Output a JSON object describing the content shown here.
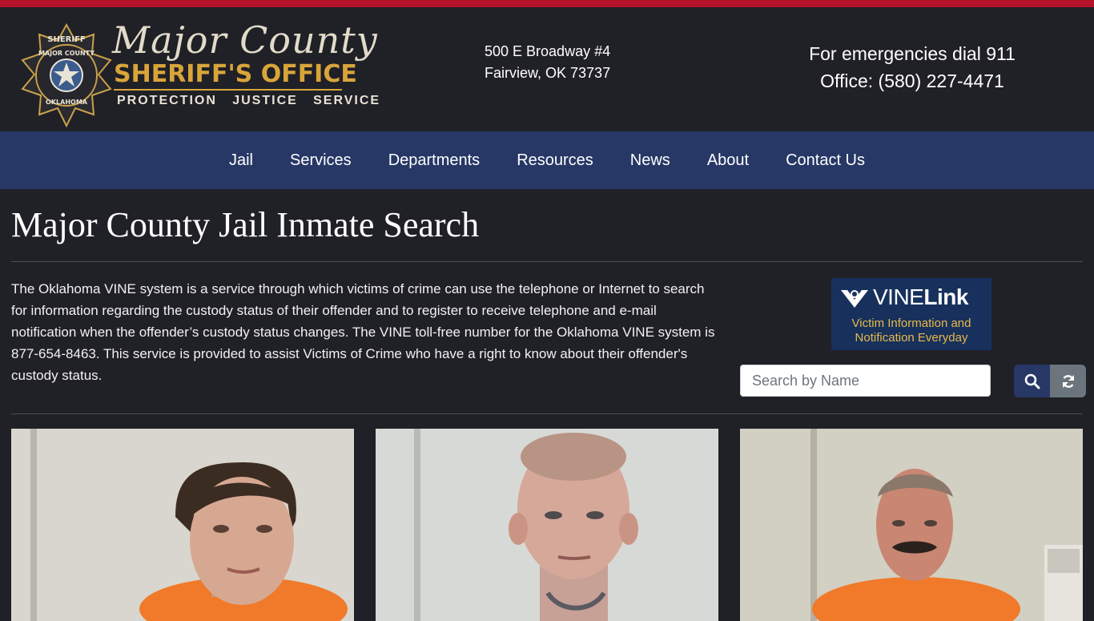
{
  "logo": {
    "script_text": "Major County",
    "office_text": "SHERIFF'S OFFICE",
    "tagline": "PROTECTION   JUSTICE   SERVICE",
    "badge_top": "SHERIFF",
    "badge_ring": "MAJOR COUNTY",
    "badge_bottom": "OKLAHOMA"
  },
  "address": {
    "line1": "500 E Broadway #4",
    "line2": "Fairview, OK 73737"
  },
  "contact": {
    "emergency": "For emergencies dial 911",
    "office": "Office: (580) 227-4471"
  },
  "nav": [
    {
      "label": "Jail"
    },
    {
      "label": "Services"
    },
    {
      "label": "Departments"
    },
    {
      "label": "Resources"
    },
    {
      "label": "News"
    },
    {
      "label": "About"
    },
    {
      "label": "Contact Us"
    }
  ],
  "page_title": "Major County Jail Inmate Search",
  "intro_text": "The Oklahoma VINE system is a service through which victims of crime can use the telephone or Internet to search for information regarding the custody status of their offender and to register to receive telephone and e-mail notification when the offender’s custody status changes. The VINE toll-free number for the Oklahoma VINE system is 877-654-8463. This service is provided to assist Victims of Crime who have a right to know about their offender's custody status.",
  "vine": {
    "brand_a": "VINE",
    "brand_b": "Link",
    "subtitle_line1": "Victim Information and",
    "subtitle_line2": "Notification Everyday"
  },
  "search": {
    "placeholder": "Search by Name",
    "value": ""
  },
  "icons": {
    "search": "search-icon",
    "reset": "refresh-icon"
  },
  "colors": {
    "top_bar": "#b5122a",
    "background": "#202027",
    "nav": "#273866",
    "gold": "#d9a53a",
    "search_button": "#273866",
    "reset_button": "#6c757d"
  }
}
